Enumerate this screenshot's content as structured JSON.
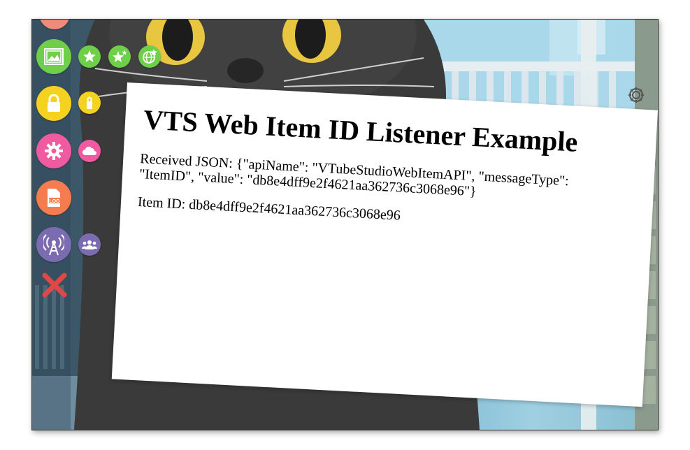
{
  "page": {
    "title": "VTS Web Item ID Listener Example",
    "received_label": "Received JSON:",
    "received_json": "{\"apiName\": \"VTubeStudioWebItemAPI\", \"messageType\": \"ItemID\", \"value\": \"db8e4dff9e2f4621aa362736c3068e96\"}",
    "item_id_label": "Item ID:",
    "item_id_value": "db8e4dff9e2f4621aa362736c3068e96"
  },
  "sidebar": {
    "items": [
      {
        "name": "background-button",
        "icon": "picture-icon",
        "color": "#6fcf4a"
      },
      {
        "name": "favorite-button",
        "icon": "star-icon",
        "color": "#6fcf4a"
      },
      {
        "name": "sparkle-button",
        "icon": "sparkle-star-icon",
        "color": "#6fcf4a"
      },
      {
        "name": "web-star-button",
        "icon": "globe-star-icon",
        "color": "#6fcf4a"
      },
      {
        "name": "lock-button",
        "icon": "lock-icon",
        "color": "#f4d21f"
      },
      {
        "name": "small-lock-button",
        "icon": "lock-small-icon",
        "color": "#f4d21f"
      },
      {
        "name": "settings-button",
        "icon": "gear-icon",
        "color": "#f05aa0"
      },
      {
        "name": "cloud-button",
        "icon": "cloud-icon",
        "color": "#f05aa0"
      },
      {
        "name": "log-button",
        "icon": "log-file-icon",
        "color": "#f57c4e"
      },
      {
        "name": "broadcast-button",
        "icon": "antenna-icon",
        "color": "#7b6bb0"
      },
      {
        "name": "collab-button",
        "icon": "people-icon",
        "color": "#7b6bb0"
      },
      {
        "name": "close-button",
        "icon": "close-icon",
        "color": "#e04848"
      }
    ]
  }
}
